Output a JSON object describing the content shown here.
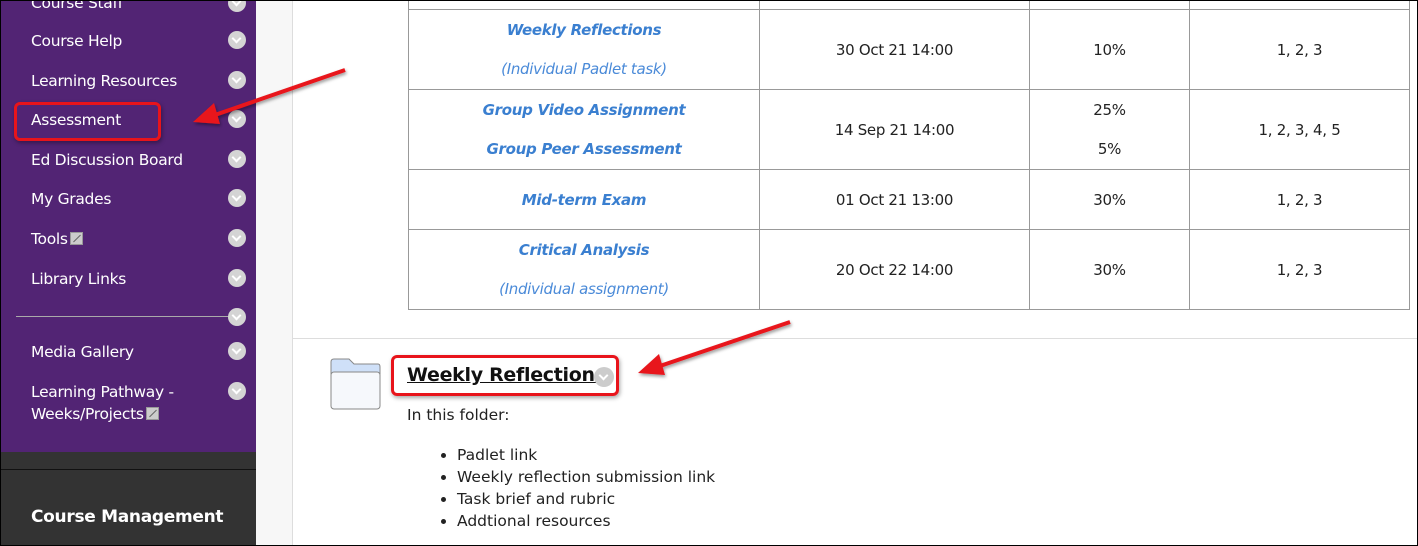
{
  "sidebar": {
    "items": [
      {
        "label": "Course Staff"
      },
      {
        "label": "Course Help"
      },
      {
        "label": "Learning Resources"
      },
      {
        "label": "Assessment"
      },
      {
        "label": "Ed Discussion Board"
      },
      {
        "label": "My Grades"
      },
      {
        "label": "Tools"
      },
      {
        "label": "Library Links"
      },
      {
        "label": "Media Gallery"
      },
      {
        "label": "Learning Pathway -"
      },
      {
        "label": "Weeks/Projects"
      }
    ],
    "highlighted": "Assessment",
    "course_management": "Course Management"
  },
  "table": {
    "rows": [
      {
        "titles": [
          "Weekly Reflections"
        ],
        "subtitle": "(Individual Padlet task)",
        "due": "30 Oct 21 14:00",
        "weights": [
          "10%"
        ],
        "outcomes": "1, 2, 3"
      },
      {
        "titles": [
          "Group Video Assignment",
          "Group Peer Assessment"
        ],
        "subtitle": "",
        "due": "14 Sep 21 14:00",
        "weights": [
          "25%",
          "5%"
        ],
        "outcomes": "1, 2, 3, 4, 5"
      },
      {
        "titles": [
          "Mid-term Exam"
        ],
        "subtitle": "",
        "due": "01 Oct 21 13:00",
        "weights": [
          "30%"
        ],
        "outcomes": "1, 2, 3"
      },
      {
        "titles": [
          "Critical Analysis"
        ],
        "subtitle": "(Individual assignment)",
        "due": "20 Oct 22 14:00",
        "weights": [
          "30%"
        ],
        "outcomes": "1, 2, 3"
      }
    ]
  },
  "folder": {
    "title": "Weekly Reflections",
    "intro": "In this folder:",
    "items": [
      "Padlet link",
      "Weekly reflection submission link",
      "Task brief and rubric",
      "Addtional resources"
    ]
  },
  "colors": {
    "sidebar": "#522474",
    "annotation": "#e8141b",
    "link": "#3a7fd0"
  }
}
